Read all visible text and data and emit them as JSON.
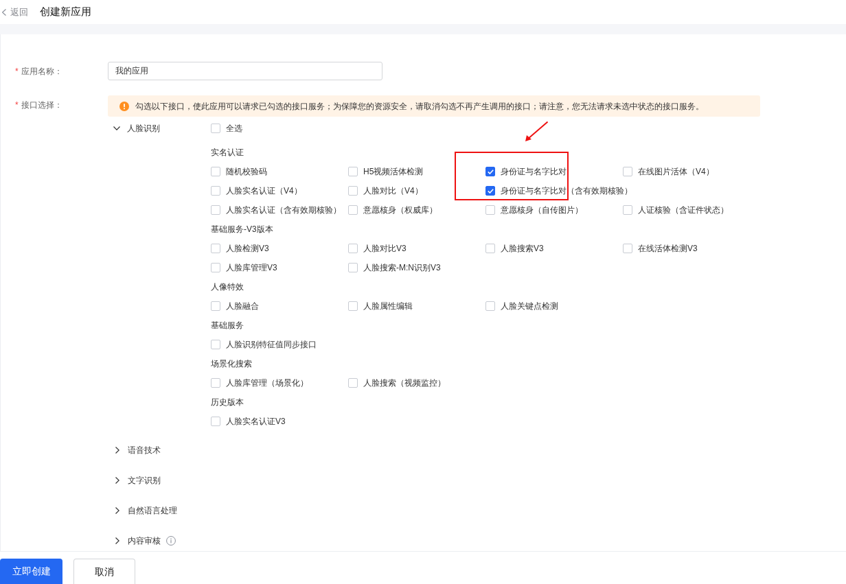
{
  "header": {
    "back_label": "返回",
    "title": "创建新应用"
  },
  "form": {
    "name_field": {
      "required_mark": "*",
      "label": "应用名称：",
      "value": "我的应用"
    },
    "api_field": {
      "required_mark": "*",
      "label": "接口选择：",
      "notice": "勾选以下接口，使此应用可以请求已勾选的接口服务；为保障您的资源安全，请取消勾选不再产生调用的接口；请注意，您无法请求未选中状态的接口服务。"
    }
  },
  "categories": [
    {
      "name": "人脸识别",
      "expanded": true,
      "select_all": {
        "label": "全选",
        "checked": false
      },
      "groups": [
        {
          "title": "实名认证",
          "rows": [
            [
              {
                "label": "随机校验码",
                "checked": false
              },
              {
                "label": "H5视频活体检测",
                "checked": false
              },
              {
                "label": "身份证与名字比对",
                "checked": true
              },
              {
                "label": "在线图片活体（V4）",
                "checked": false
              }
            ],
            [
              {
                "label": "人脸实名认证（V4）",
                "checked": false
              },
              {
                "label": "人脸对比（V4）",
                "checked": false
              },
              {
                "label": "身份证与名字比对（含有效期核验）",
                "checked": true
              }
            ],
            [
              {
                "label": "人脸实名认证（含有效期核验）",
                "checked": false
              },
              {
                "label": "意愿核身（权威库）",
                "checked": false
              },
              {
                "label": "意愿核身（自传图片）",
                "checked": false
              },
              {
                "label": "人证核验（含证件状态）",
                "checked": false
              }
            ]
          ]
        },
        {
          "title": "基础服务-V3版本",
          "rows": [
            [
              {
                "label": "人脸检测V3",
                "checked": false
              },
              {
                "label": "人脸对比V3",
                "checked": false
              },
              {
                "label": "人脸搜索V3",
                "checked": false
              },
              {
                "label": "在线活体检测V3",
                "checked": false
              }
            ],
            [
              {
                "label": "人脸库管理V3",
                "checked": false
              },
              {
                "label": "人脸搜索-M:N识别V3",
                "checked": false
              }
            ]
          ]
        },
        {
          "title": "人像特效",
          "rows": [
            [
              {
                "label": "人脸融合",
                "checked": false
              },
              {
                "label": "人脸属性编辑",
                "checked": false
              },
              {
                "label": "人脸关键点检测",
                "checked": false
              }
            ]
          ]
        },
        {
          "title": "基础服务",
          "rows": [
            [
              {
                "label": "人脸识别特征值同步接口",
                "checked": false
              }
            ]
          ]
        },
        {
          "title": "场景化搜索",
          "rows": [
            [
              {
                "label": "人脸库管理（场景化）",
                "checked": false
              },
              {
                "label": "人脸搜索（视频监控）",
                "checked": false
              }
            ]
          ]
        },
        {
          "title": "历史版本",
          "rows": [
            [
              {
                "label": "人脸实名认证V3",
                "checked": false
              }
            ]
          ]
        }
      ]
    },
    {
      "name": "语音技术",
      "expanded": false
    },
    {
      "name": "文字识别",
      "expanded": false
    },
    {
      "name": "自然语言处理",
      "expanded": false
    },
    {
      "name": "内容审核",
      "expanded": false,
      "info": true
    }
  ],
  "buttons": [
    {
      "label": "立即创建",
      "kind": "primary"
    },
    {
      "label": "取消",
      "kind": "default"
    }
  ]
}
